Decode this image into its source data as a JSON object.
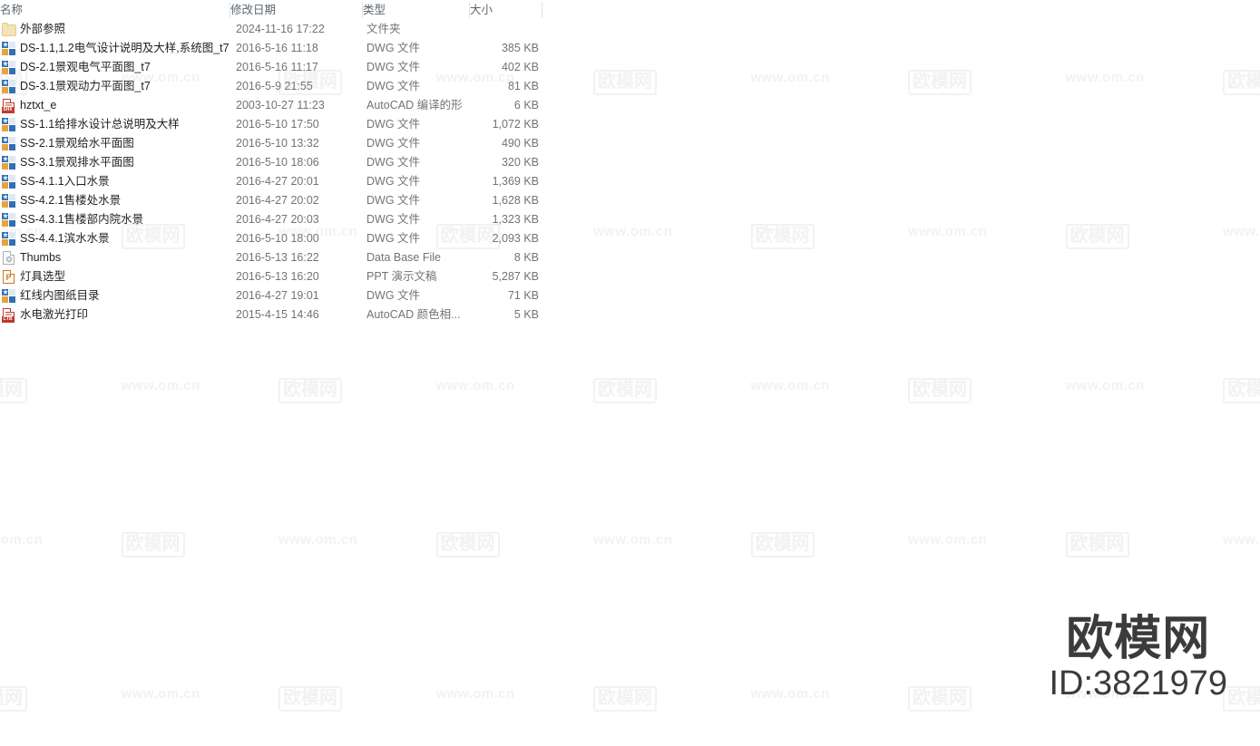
{
  "columns": {
    "name": "名称",
    "date": "修改日期",
    "type": "类型",
    "size": "大小"
  },
  "files": [
    {
      "icon": "folder-icon",
      "name": "外部参照",
      "date": "2024-11-16 17:22",
      "type": "文件夹",
      "size": ""
    },
    {
      "icon": "dwg-file-icon",
      "name": "DS-1.1,1.2电气设计说明及大样,系统图_t7",
      "date": "2016-5-16 11:18",
      "type": "DWG 文件",
      "size": "385 KB"
    },
    {
      "icon": "dwg-file-icon",
      "name": "DS-2.1景观电气平面图_t7",
      "date": "2016-5-16 11:17",
      "type": "DWG 文件",
      "size": "402 KB"
    },
    {
      "icon": "dwg-file-icon",
      "name": "DS-3.1景观动力平面图_t7",
      "date": "2016-5-9 21:55",
      "type": "DWG 文件",
      "size": "81 KB"
    },
    {
      "icon": "shx-file-icon",
      "name": "hztxt_e",
      "date": "2003-10-27 11:23",
      "type": "AutoCAD 编译的形",
      "size": "6 KB"
    },
    {
      "icon": "dwg-file-icon",
      "name": "SS-1.1给排水设计总说明及大样",
      "date": "2016-5-10 17:50",
      "type": "DWG 文件",
      "size": "1,072 KB"
    },
    {
      "icon": "dwg-file-icon",
      "name": "SS-2.1景观给水平面图",
      "date": "2016-5-10 13:32",
      "type": "DWG 文件",
      "size": "490 KB"
    },
    {
      "icon": "dwg-file-icon",
      "name": "SS-3.1景观排水平面图",
      "date": "2016-5-10 18:06",
      "type": "DWG 文件",
      "size": "320 KB"
    },
    {
      "icon": "dwg-file-icon",
      "name": "SS-4.1.1入口水景",
      "date": "2016-4-27 20:01",
      "type": "DWG 文件",
      "size": "1,369 KB"
    },
    {
      "icon": "dwg-file-icon",
      "name": "SS-4.2.1售楼处水景",
      "date": "2016-4-27 20:02",
      "type": "DWG 文件",
      "size": "1,628 KB"
    },
    {
      "icon": "dwg-file-icon",
      "name": "SS-4.3.1售楼部内院水景",
      "date": "2016-4-27 20:03",
      "type": "DWG 文件",
      "size": "1,323 KB"
    },
    {
      "icon": "dwg-file-icon",
      "name": "SS-4.4.1滨水水景",
      "date": "2016-5-10 18:00",
      "type": "DWG 文件",
      "size": "2,093 KB"
    },
    {
      "icon": "database-file-icon",
      "name": "Thumbs",
      "date": "2016-5-13 16:22",
      "type": "Data Base File",
      "size": "8 KB"
    },
    {
      "icon": "powerpoint-file-icon",
      "name": "灯具选型",
      "date": "2016-5-13 16:20",
      "type": "PPT 演示文稿",
      "size": "5,287 KB"
    },
    {
      "icon": "dwg-file-icon",
      "name": "红线内图纸目录",
      "date": "2016-4-27 19:01",
      "type": "DWG 文件",
      "size": "71 KB"
    },
    {
      "icon": "ctb-file-icon",
      "name": "水电激光打印",
      "date": "2015-4-15 14:46",
      "type": "AutoCAD 颜色相...",
      "size": "5 KB"
    }
  ],
  "watermark": {
    "brand": "欧模网",
    "url": "www.om.cn",
    "main_brand": "欧模网",
    "main_id": "ID:3821979",
    "tile_color": "#f2f2f2",
    "main_color": "#3b3b3b"
  },
  "icon_labels": {
    "shx": "SHX",
    "ctb": "CTB",
    "ppt": "P"
  }
}
